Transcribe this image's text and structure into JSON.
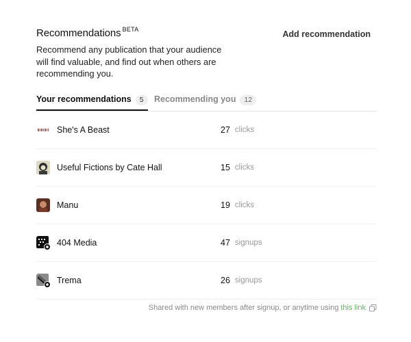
{
  "header": {
    "title": "Recommendations",
    "beta": "BETA",
    "add_label": "Add recommendation",
    "description": "Recommend any publication that your audience will find valuable, and find out when others are recommending you."
  },
  "tabs": [
    {
      "label": "Your recommendations",
      "count": "5",
      "active": true
    },
    {
      "label": "Recommending you",
      "count": "12",
      "active": false
    }
  ],
  "recommendations": [
    {
      "name": "She's A Beast",
      "count": "27",
      "unit": "clicks",
      "icon": "she-is-a-beast-logo-icon"
    },
    {
      "name": "Useful Fictions by Cate Hall",
      "count": "15",
      "unit": "clicks",
      "icon": "useful-fictions-logo-icon"
    },
    {
      "name": "Manu",
      "count": "19",
      "unit": "clicks",
      "icon": "manu-avatar-icon"
    },
    {
      "name": "404 Media",
      "count": "47",
      "unit": "signups",
      "icon": "404-media-logo-icon"
    },
    {
      "name": "Trema",
      "count": "26",
      "unit": "signups",
      "icon": "trema-logo-icon"
    }
  ],
  "footer": {
    "text": "Shared with new members after signup, or anytime using",
    "link": "this link",
    "link_color": "#5cb85c"
  }
}
